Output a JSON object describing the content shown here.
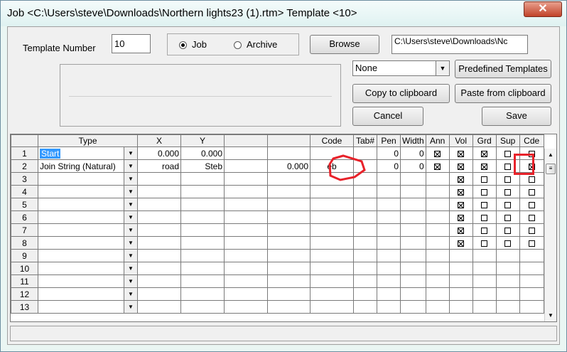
{
  "window": {
    "title": "Job <C:\\Users\\steve\\Downloads\\Northern lights23 (1).rtm> Template <10>",
    "close_glyph": "✕"
  },
  "form": {
    "template_number_label": "Template Number",
    "template_number_value": "10",
    "radio_job_label": "Job",
    "radio_archive_label": "Archive",
    "selected_radio": "Job",
    "browse_label": "Browse",
    "path_text": "C:\\Users\\steve\\Downloads\\Nc",
    "dropdown_value": "None",
    "predefined_label": "Predefined Templates",
    "copy_label": "Copy to clipboard",
    "paste_label": "Paste from clipboard",
    "cancel_label": "Cancel",
    "save_label": "Save"
  },
  "grid": {
    "headers": [
      "Type",
      "X",
      "Y",
      "",
      "",
      "Code",
      "Tab#",
      "Pen",
      "Width",
      "Ann",
      "Vol",
      "Grd",
      "Sup",
      "Cde"
    ],
    "rows": [
      {
        "n": "1",
        "type": "Start",
        "x": "0.000",
        "y": "0.000",
        "c4": "",
        "c5": "",
        "code": "",
        "tab": "",
        "pen": "0",
        "width": "0",
        "ann": true,
        "vol": true,
        "grd": true,
        "sup": false,
        "cde": false
      },
      {
        "n": "2",
        "type": "Join String (Natural)",
        "x": "road",
        "y": "Steb",
        "c4": "",
        "c5": "0.000",
        "code": "eb",
        "tab": "",
        "pen": "0",
        "width": "0",
        "ann": true,
        "vol": true,
        "grd": true,
        "sup": false,
        "cde": true
      },
      {
        "n": "3",
        "type": "",
        "x": "",
        "y": "",
        "c4": "",
        "c5": "",
        "code": "",
        "tab": "",
        "pen": "",
        "width": "",
        "ann": null,
        "vol": true,
        "grd": false,
        "sup": false,
        "cde": false
      },
      {
        "n": "4",
        "type": "",
        "x": "",
        "y": "",
        "c4": "",
        "c5": "",
        "code": "",
        "tab": "",
        "pen": "",
        "width": "",
        "ann": null,
        "vol": true,
        "grd": false,
        "sup": false,
        "cde": false
      },
      {
        "n": "5",
        "type": "",
        "x": "",
        "y": "",
        "c4": "",
        "c5": "",
        "code": "",
        "tab": "",
        "pen": "",
        "width": "",
        "ann": null,
        "vol": true,
        "grd": false,
        "sup": false,
        "cde": false
      },
      {
        "n": "6",
        "type": "",
        "x": "",
        "y": "",
        "c4": "",
        "c5": "",
        "code": "",
        "tab": "",
        "pen": "",
        "width": "",
        "ann": null,
        "vol": true,
        "grd": false,
        "sup": false,
        "cde": false
      },
      {
        "n": "7",
        "type": "",
        "x": "",
        "y": "",
        "c4": "",
        "c5": "",
        "code": "",
        "tab": "",
        "pen": "",
        "width": "",
        "ann": null,
        "vol": true,
        "grd": false,
        "sup": false,
        "cde": false
      },
      {
        "n": "8",
        "type": "",
        "x": "",
        "y": "",
        "c4": "",
        "c5": "",
        "code": "",
        "tab": "",
        "pen": "",
        "width": "",
        "ann": null,
        "vol": true,
        "grd": false,
        "sup": false,
        "cde": false
      },
      {
        "n": "9",
        "type": "",
        "x": "",
        "y": "",
        "c4": "",
        "c5": "",
        "code": "",
        "tab": "",
        "pen": "",
        "width": "",
        "ann": null,
        "vol": null,
        "grd": null,
        "sup": null,
        "cde": null
      },
      {
        "n": "10",
        "type": "",
        "x": "",
        "y": "",
        "c4": "",
        "c5": "",
        "code": "",
        "tab": "",
        "pen": "",
        "width": "",
        "ann": null,
        "vol": null,
        "grd": null,
        "sup": null,
        "cde": null
      },
      {
        "n": "11",
        "type": "",
        "x": "",
        "y": "",
        "c4": "",
        "c5": "",
        "code": "",
        "tab": "",
        "pen": "",
        "width": "",
        "ann": null,
        "vol": null,
        "grd": null,
        "sup": null,
        "cde": null
      },
      {
        "n": "12",
        "type": "",
        "x": "",
        "y": "",
        "c4": "",
        "c5": "",
        "code": "",
        "tab": "",
        "pen": "",
        "width": "",
        "ann": null,
        "vol": null,
        "grd": null,
        "sup": null,
        "cde": null
      },
      {
        "n": "13",
        "type": "",
        "x": "",
        "y": "",
        "c4": "",
        "c5": "",
        "code": "",
        "tab": "",
        "pen": "",
        "width": "",
        "ann": null,
        "vol": null,
        "grd": null,
        "sup": null,
        "cde": null
      }
    ]
  },
  "colors": {
    "annotation": "#e8222a",
    "selection": "#3399ff"
  },
  "icons": {
    "dropdown": "chevron-down-icon",
    "scroll_up": "arrow-up-icon",
    "scroll_down": "arrow-down-icon",
    "close": "close-icon"
  }
}
